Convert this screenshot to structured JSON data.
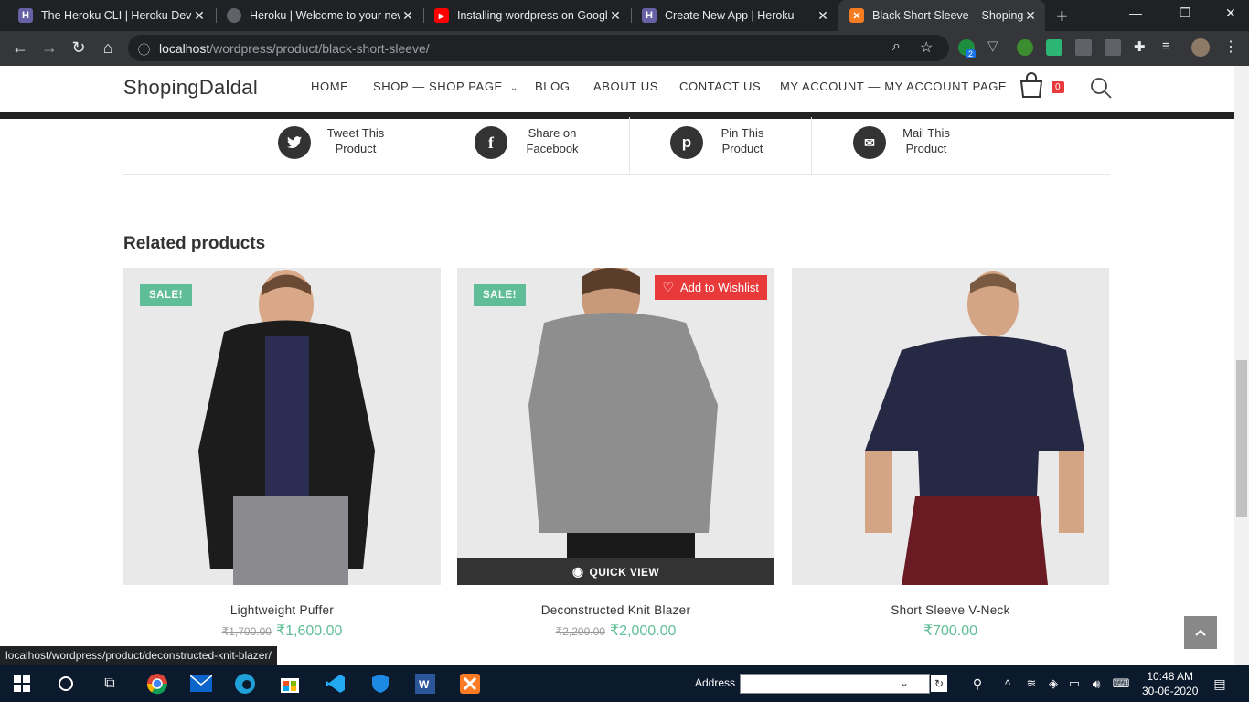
{
  "browser": {
    "tabs": [
      {
        "title": "The Heroku CLI | Heroku Dev C",
        "favicon": "heroku-icon",
        "active": false
      },
      {
        "title": "Heroku | Welcome to your new",
        "favicon": "globe-icon",
        "active": false
      },
      {
        "title": "Installing wordpress on Googl",
        "favicon": "youtube-icon",
        "active": false
      },
      {
        "title": "Create New App | Heroku",
        "favicon": "heroku-icon",
        "active": false
      },
      {
        "title": "Black Short Sleeve – ShopingD",
        "favicon": "xampp-icon",
        "active": true
      }
    ],
    "url_host": "localhost",
    "url_path": "/wordpress/product/black-short-sleeve/",
    "extension_badge": "2",
    "status_url": "localhost/wordpress/product/deconstructed-knit-blazer/"
  },
  "site": {
    "logo": "ShopingDaldal",
    "menu": [
      {
        "label": "HOME"
      },
      {
        "label": "SHOP — SHOP PAGE"
      },
      {
        "label": "BLOG"
      },
      {
        "label": "ABOUT US"
      },
      {
        "label": "CONTACT US"
      },
      {
        "label": "MY ACCOUNT — MY ACCOUNT PAGE"
      }
    ],
    "cart_count": "0"
  },
  "share": [
    {
      "line1": "Tweet This",
      "line2": "Product",
      "icon": "twitter-icon",
      "glyph": "t"
    },
    {
      "line1": "Share on",
      "line2": "Facebook",
      "icon": "facebook-icon",
      "glyph": "f"
    },
    {
      "line1": "Pin This",
      "line2": "Product",
      "icon": "pinterest-icon",
      "glyph": "p"
    },
    {
      "line1": "Mail This",
      "line2": "Product",
      "icon": "mail-icon",
      "glyph": "✉"
    }
  ],
  "related": {
    "heading": "Related products",
    "sale_label": "SALE!",
    "wishlist_label": "Add to Wishlist",
    "quickview_label": "QUICK VIEW",
    "products": [
      {
        "name": "Lightweight Puffer",
        "old_price": "₹1,700.00",
        "price": "₹1,600.00",
        "on_sale": true
      },
      {
        "name": "Deconstructed Knit Blazer",
        "old_price": "₹2,200.00",
        "price": "₹2,000.00",
        "on_sale": true
      },
      {
        "name": "Short Sleeve V-Neck",
        "old_price": "",
        "price": "₹700.00",
        "on_sale": false
      }
    ]
  },
  "taskbar": {
    "address_label": "Address",
    "time": "10:48 AM",
    "date": "30-06-2020"
  },
  "colors": {
    "accent_green": "#5fbd97",
    "wishlist_red": "#e83a3a",
    "dark": "#333333"
  }
}
